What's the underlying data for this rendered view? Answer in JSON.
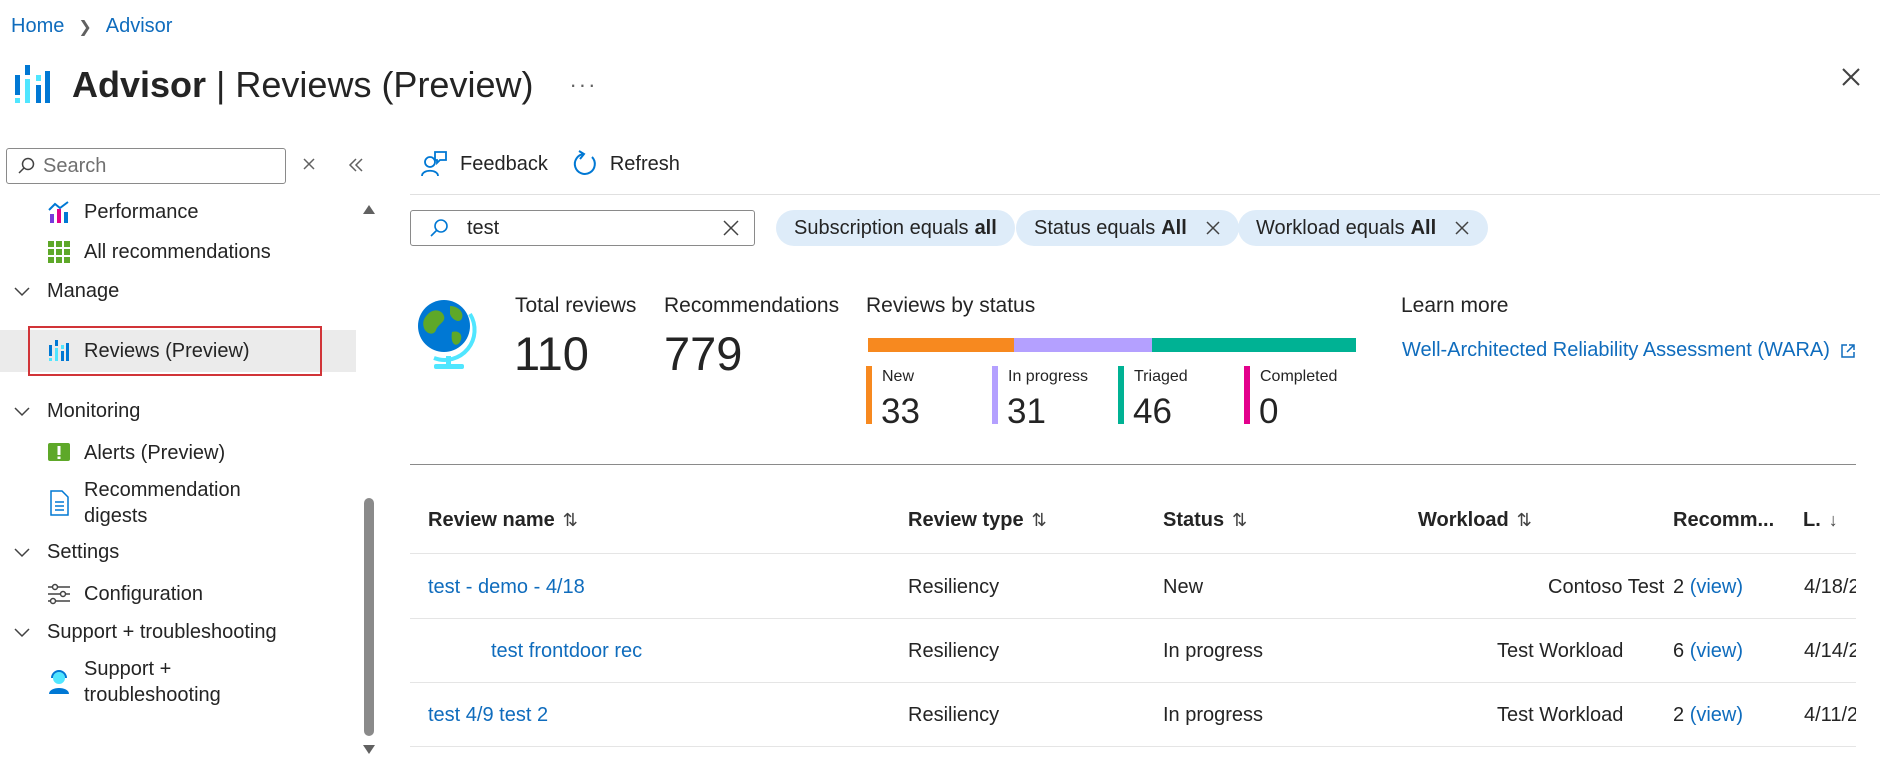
{
  "breadcrumb": {
    "home": "Home",
    "advisor": "Advisor"
  },
  "header": {
    "title": "Advisor",
    "separator": "|",
    "subtitle": "Reviews (Preview)",
    "more": "···"
  },
  "sidebar": {
    "search_placeholder": "Search",
    "items": [
      {
        "label": "Performance",
        "icon": "performance-icon"
      },
      {
        "label": "All recommendations",
        "icon": "grid-icon"
      },
      {
        "label": "Manage",
        "type": "group"
      },
      {
        "label": "Reviews (Preview)",
        "icon": "advisor-icon",
        "selected": true
      },
      {
        "label": "Monitoring",
        "type": "group"
      },
      {
        "label": "Alerts (Preview)",
        "icon": "alert-icon"
      },
      {
        "label": "Recommendation",
        "label2": "digests",
        "icon": "document-icon"
      },
      {
        "label": "Settings",
        "type": "group"
      },
      {
        "label": "Configuration",
        "icon": "sliders-icon"
      },
      {
        "label": "Support + troubleshooting",
        "type": "group"
      },
      {
        "label": "Support +",
        "label2": "troubleshooting",
        "icon": "support-icon"
      }
    ]
  },
  "toolbar": {
    "feedback": "Feedback",
    "refresh": "Refresh"
  },
  "filters": {
    "search_value": "test",
    "pills": [
      {
        "text": "Subscription equals",
        "value": "all",
        "removable": false
      },
      {
        "text": "Status equals",
        "value": "All",
        "removable": true
      },
      {
        "text": "Workload equals",
        "value": "All",
        "removable": true
      }
    ]
  },
  "summary": {
    "total_reviews_label": "Total reviews",
    "total_reviews": "110",
    "recommendations_label": "Recommendations",
    "recommendations": "779",
    "by_status_label": "Reviews by status",
    "statuses": [
      {
        "label": "New",
        "count": "33",
        "color": "#f7891f"
      },
      {
        "label": "In progress",
        "count": "31",
        "color": "#b4a0ff"
      },
      {
        "label": "Triaged",
        "count": "46",
        "color": "#00b294"
      },
      {
        "label": "Completed",
        "count": "0",
        "color": "#e3008c"
      }
    ],
    "learn_more_label": "Learn more",
    "learn_more_link": "Well-Architected Reliability Assessment (WARA)"
  },
  "table": {
    "columns": [
      "Review name",
      "Review type",
      "Status",
      "Workload",
      "Recomm...",
      "L."
    ],
    "rows": [
      {
        "name": "test - demo - 4/18",
        "type": "Resiliency",
        "status": "New",
        "workload": "Contoso Test",
        "rec_count": "2",
        "view": "(view)",
        "last": "4/18/2"
      },
      {
        "name": "test frontdoor rec",
        "type": "Resiliency",
        "status": "In progress",
        "workload": "Test Workload",
        "rec_count": "6",
        "view": "(view)",
        "last": "4/14/2"
      },
      {
        "name": "test 4/9 test 2",
        "type": "Resiliency",
        "status": "In progress",
        "workload": "Test Workload",
        "rec_count": "2",
        "view": "(view)",
        "last": "4/11/2"
      }
    ]
  }
}
